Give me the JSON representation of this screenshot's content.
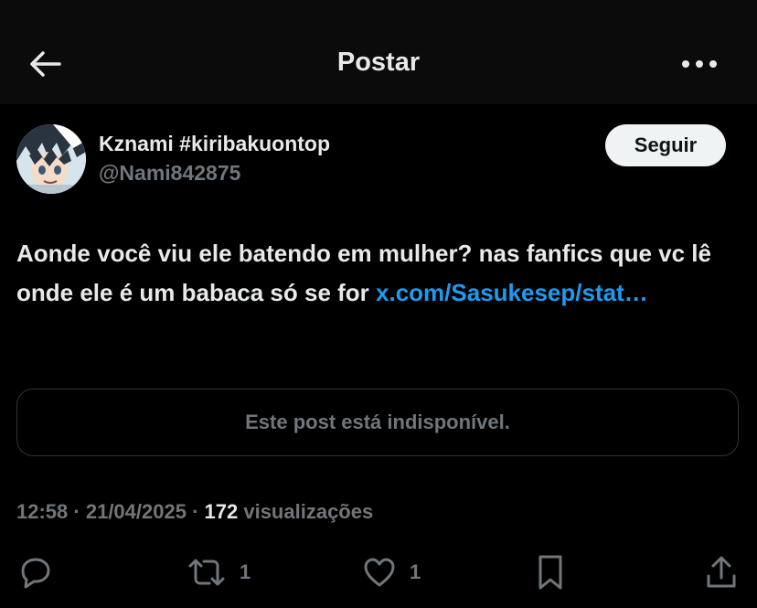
{
  "header": {
    "title": "Postar",
    "back_icon": "arrow-left-icon",
    "more_icon": "more-horizontal-icon"
  },
  "author": {
    "display_name": "Kznami #kiribakuontop",
    "handle": "@Nami842875",
    "avatar_icon": "anime-avatar"
  },
  "follow": {
    "label": "Seguir"
  },
  "tweet": {
    "text": "Aonde você viu ele batendo em mulher? nas fanfics que vc lê onde ele é um babaca só se for ",
    "link_text": "x.com/​Sasukesep/stat…"
  },
  "quoted": {
    "unavailable_text": "Este post está indisponível."
  },
  "meta": {
    "time": "12:58",
    "separator": " · ",
    "date": "21/04/2025",
    "views_count": "172",
    "views_label": " visualizações"
  },
  "actions": {
    "reply": {
      "icon": "reply-icon"
    },
    "repost": {
      "icon": "repost-icon",
      "count": "1"
    },
    "like": {
      "icon": "heart-icon",
      "count": "1"
    },
    "bookmark": {
      "icon": "bookmark-icon"
    },
    "share": {
      "icon": "share-icon"
    }
  },
  "colors": {
    "background": "#000000",
    "header_bg": "#0b0b0b",
    "text_primary": "#e7e9ea",
    "text_secondary": "#71767b",
    "link": "#1d9bf0",
    "border": "#2f3336",
    "follow_bg": "#eff3f4"
  }
}
